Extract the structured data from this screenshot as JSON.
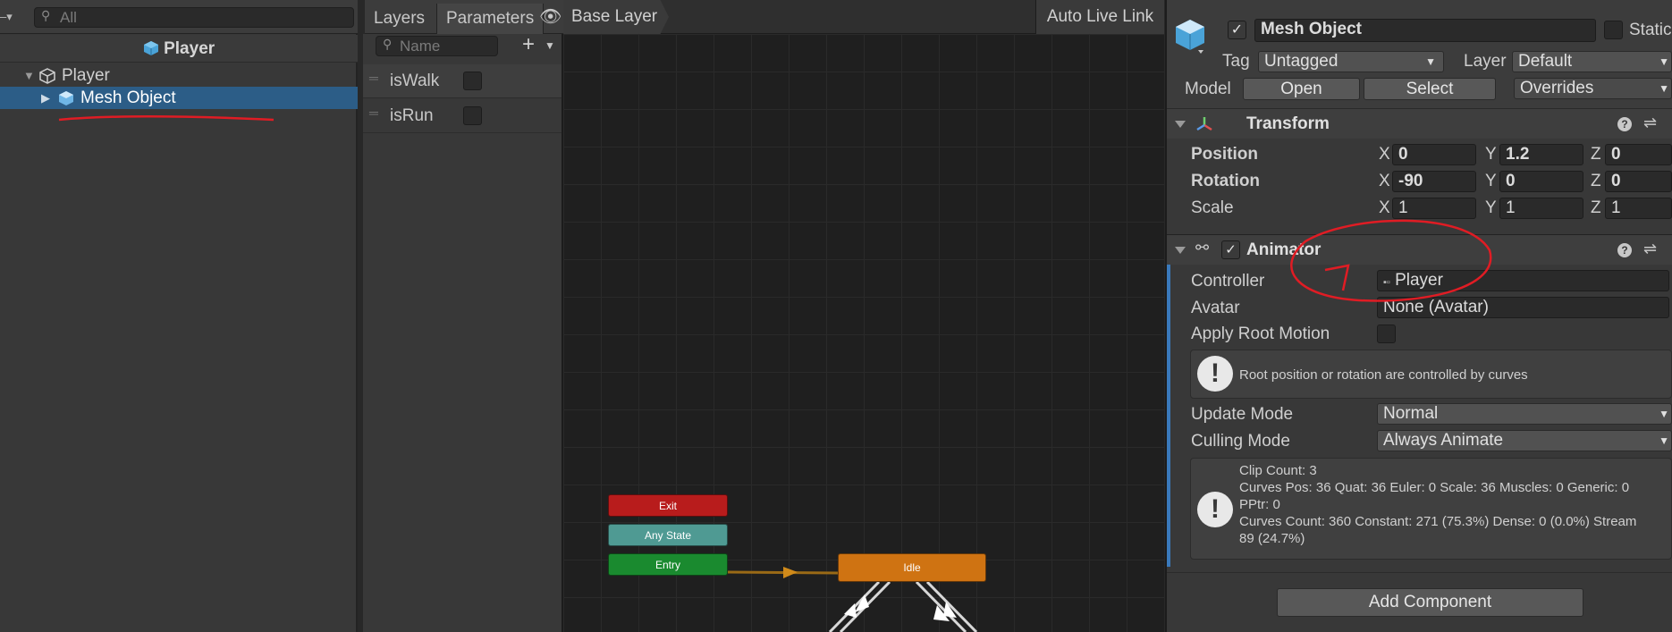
{
  "hierarchy": {
    "search_placeholder": "All",
    "scene_title": "Player",
    "items": [
      {
        "label": "Player"
      },
      {
        "label": "Mesh Object"
      }
    ]
  },
  "animator": {
    "tabs": [
      {
        "label": "Layers"
      },
      {
        "label": "Parameters"
      }
    ],
    "name_placeholder": "Name",
    "parameters": [
      {
        "name": "isWalk"
      },
      {
        "name": "isRun"
      }
    ],
    "breadcrumb": "Base Layer",
    "auto_live_link": "Auto Live Link",
    "states": {
      "exit": {
        "label": "Exit",
        "color": "#b81c1c"
      },
      "any": {
        "label": "Any State",
        "color": "#4f9a93"
      },
      "entry": {
        "label": "Entry",
        "color": "#1a8a2f"
      },
      "idle": {
        "label": "Idle",
        "color": "#cf7312"
      }
    }
  },
  "inspector": {
    "object_name": "Mesh Object",
    "static_label": "Static",
    "tag_label": "Tag",
    "tag_value": "Untagged",
    "layer_label": "Layer",
    "layer_value": "Default",
    "model_label": "Model",
    "open_label": "Open",
    "select_label": "Select",
    "overrides_label": "Overrides",
    "transform": {
      "title": "Transform",
      "position": {
        "label": "Position",
        "x": "0",
        "y": "1.2",
        "z": "0"
      },
      "rotation": {
        "label": "Rotation",
        "x": "-90",
        "y": "0",
        "z": "0"
      },
      "scale": {
        "label": "Scale",
        "x": "1",
        "y": "1",
        "z": "1"
      },
      "axis": {
        "x": "X",
        "y": "Y",
        "z": "Z"
      }
    },
    "animator": {
      "title": "Animator",
      "controller_label": "Controller",
      "controller_value": "Player",
      "avatar_label": "Avatar",
      "avatar_value": "None (Avatar)",
      "apply_root_motion_label": "Apply Root Motion",
      "curves_message": "Root position or rotation are controlled by curves",
      "update_mode_label": "Update Mode",
      "update_mode_value": "Normal",
      "culling_mode_label": "Culling Mode",
      "culling_mode_value": "Always Animate",
      "info_lines": [
        "Clip Count: 3",
        "Curves Pos: 36 Quat: 36 Euler: 0 Scale: 36 Muscles: 0 Generic: 0",
        "PPtr: 0",
        "Curves Count: 360 Constant: 271 (75.3%) Dense: 0 (0.0%) Stream",
        "89 (24.7%)"
      ]
    },
    "add_component": "Add Component"
  },
  "colors": {
    "selection": "#2c5d87",
    "annotation": "#e01c24"
  }
}
